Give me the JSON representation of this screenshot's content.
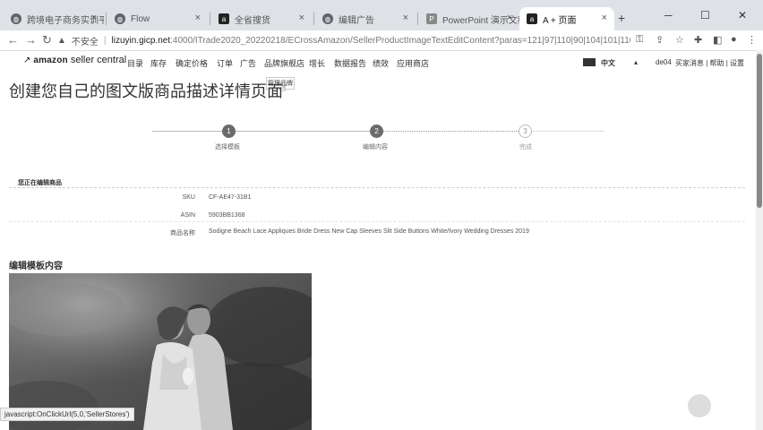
{
  "browser": {
    "tabs": [
      {
        "label": "跨境电子商务实训平台",
        "icon": "globe-icon",
        "active": false
      },
      {
        "label": "Flow",
        "icon": "globe-icon",
        "active": false
      },
      {
        "label": "全省搜货",
        "icon": "amazon-icon",
        "active": false
      },
      {
        "label": "编辑广告",
        "icon": "globe-icon",
        "active": false
      },
      {
        "label": "PowerPoint 演示文稿",
        "icon": "powerpoint-icon",
        "active": false
      },
      {
        "label": "A + 页面",
        "icon": "amazon-icon",
        "active": true
      }
    ],
    "new_tab": "+",
    "url_warning": "不安全",
    "url_host": "lizuyin.gicp.net",
    "url_path": ":4000/ITrade2020_20220218/ECrossAmazon/SellerProductImageTextEditContent?paras=121|97|110|90|104|101|110|103|6..."
  },
  "header": {
    "logo_brand": "amazon",
    "logo_text": "seller central",
    "menu": [
      "目录",
      "库存",
      "确定价格",
      "订单",
      "广告",
      "品牌旗舰店",
      "增长",
      "数据报告",
      "绩效",
      "应用商店"
    ],
    "dropdown_item": "管理品牌",
    "language": "中文",
    "store": "de04",
    "links": "买家消息 | 帮助 | 设置"
  },
  "page": {
    "title": "创建您自己的图文版商品描述详情页面",
    "steps": [
      {
        "number": "1",
        "label": "选择模板"
      },
      {
        "number": "2",
        "label": "编辑内容"
      },
      {
        "number": "3",
        "label": "完成"
      }
    ],
    "editing_heading": "您正在编辑商品",
    "sku_label": "SKU",
    "sku_value": "CF-AE47-31B1",
    "asin_label": "ASIN",
    "asin_value": "5903BB1368",
    "name_label": "商品名称",
    "name_value": "Sodigne Beach Lace Appliques Bride Dress New Cap Sleeves Slit Side Buttons White/Ivory Wedding Dresses 2019",
    "edit_section_heading": "编辑模板内容"
  },
  "status_bar": "javascript:OnClickUrl(5,0,'SellerStores')"
}
